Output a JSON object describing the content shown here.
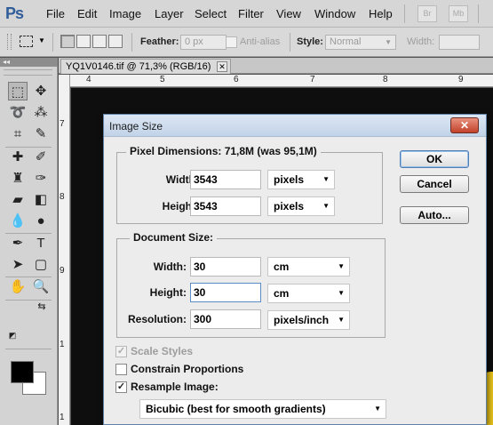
{
  "app": {
    "logo": "Ps"
  },
  "menu": [
    "File",
    "Edit",
    "Image",
    "Layer",
    "Select",
    "Filter",
    "View",
    "Window",
    "Help"
  ],
  "badges": [
    "Br",
    "Mb"
  ],
  "options": {
    "feather_label": "Feather:",
    "feather_value": "0 px",
    "antialias_label": "Anti-alias",
    "style_label": "Style:",
    "style_value": "Normal",
    "width_label": "Width:"
  },
  "document": {
    "tab_title": "YQ1V0146.tif @ 71,3% (RGB/16)",
    "hruler_ticks": [
      "4",
      "5",
      "6",
      "7",
      "8"
    ],
    "vruler_ticks": [
      "6",
      "7",
      "8",
      "9",
      "1",
      "1"
    ]
  },
  "dialog": {
    "title": "Image Size",
    "pixel_dimensions": {
      "legend": "Pixel Dimensions:  71,8M (was 95,1M)",
      "width_label": "Width:",
      "width_value": "3543",
      "width_unit": "pixels",
      "height_label": "Height:",
      "height_value": "3543",
      "height_unit": "pixels"
    },
    "document_size": {
      "legend": "Document Size:",
      "width_label": "Width:",
      "width_value": "30",
      "width_unit": "cm",
      "height_label": "Height:",
      "height_value": "30",
      "height_unit": "cm",
      "resolution_label": "Resolution:",
      "resolution_value": "300",
      "resolution_unit": "pixels/inch"
    },
    "buttons": {
      "ok": "OK",
      "cancel": "Cancel",
      "auto": "Auto..."
    },
    "checkboxes": {
      "scale_styles": {
        "label": "Scale Styles",
        "checked": true,
        "enabled": false
      },
      "constrain": {
        "label": "Constrain Proportions",
        "checked": false,
        "enabled": true
      },
      "resample": {
        "label": "Resample Image:",
        "checked": true,
        "enabled": true
      }
    },
    "resample_method": "Bicubic (best for smooth gradients)"
  }
}
